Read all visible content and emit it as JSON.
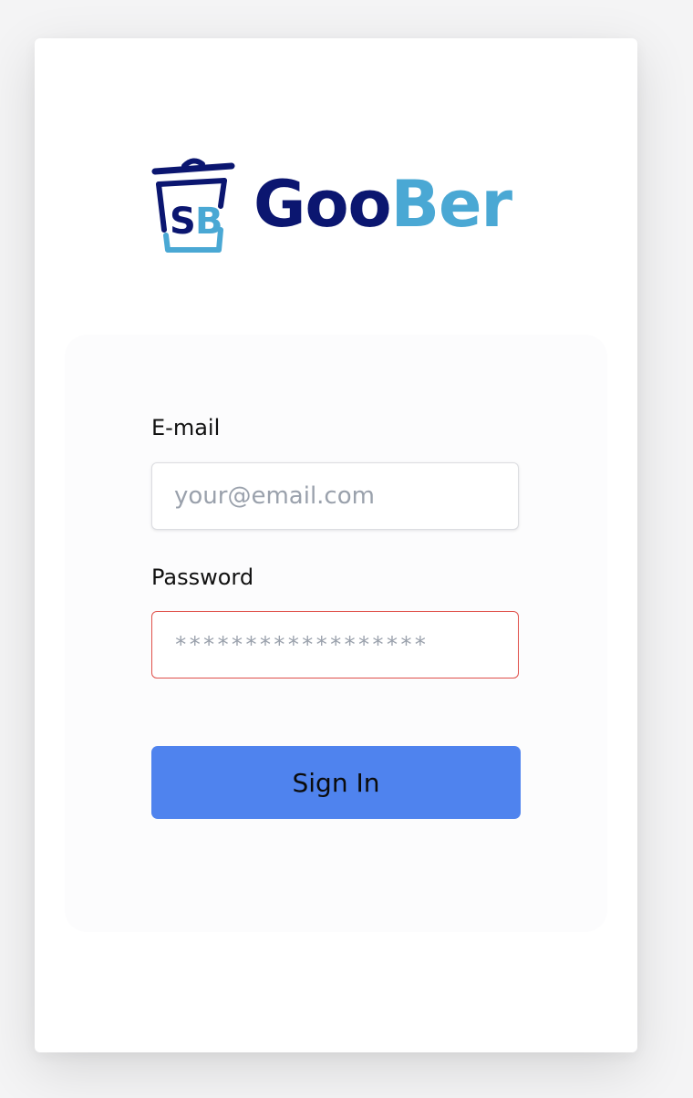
{
  "brand": {
    "name_part1": "Goo",
    "name_part2": "Ber",
    "logo_icon": "trash-bin-sb-icon",
    "colors": {
      "primary_dark": "#0b1670",
      "primary_light": "#4aa8d4"
    }
  },
  "login_form": {
    "email_label": "E-mail",
    "email_placeholder": "your@email.com",
    "email_value": "",
    "password_label": "Password",
    "password_placeholder": "******************",
    "password_value": "",
    "submit_label": "Sign In",
    "submit_color": "#4f83ee",
    "error_color": "#e0504a"
  }
}
